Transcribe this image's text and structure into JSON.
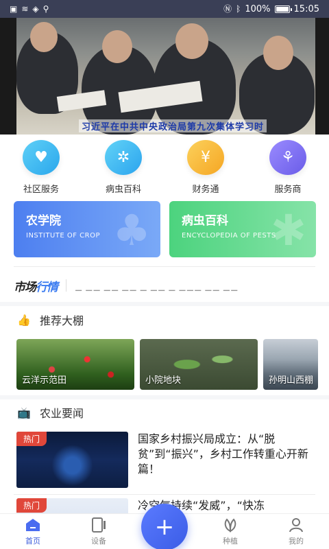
{
  "status_bar": {
    "battery": "100%",
    "time": "15:05",
    "battery_level": 1.0
  },
  "banner": {
    "caption": "习近平在中共中央政治局第九次集体学习时"
  },
  "services": [
    {
      "label": "社区服务",
      "icon": "community-heart-icon",
      "color": "#3bb8f0"
    },
    {
      "label": "病虫百科",
      "icon": "bug-icon",
      "color": "#3bbcf2"
    },
    {
      "label": "财务通",
      "icon": "piggy-bank-icon",
      "color": "#f7b733"
    },
    {
      "label": "服务商",
      "icon": "provider-icon",
      "color": "#7a6ff0"
    }
  ],
  "cards": [
    {
      "title": "农学院",
      "subtitle": "INSTITUTE OF CROP"
    },
    {
      "title": "病虫百科",
      "subtitle": "ENCYCLOPEDIA OF PESTS"
    }
  ],
  "market": {
    "logo_part1": "市场",
    "logo_part2": "行情"
  },
  "sections": {
    "greenhouses_title": "推荐大棚",
    "news_title": "农业要闻"
  },
  "greenhouses": [
    {
      "label": "云洋示范田"
    },
    {
      "label": "小院地块"
    },
    {
      "label": "孙明山西棚"
    }
  ],
  "news": [
    {
      "badge": "热门",
      "title": "国家乡村振兴局成立：从“脱贫”到“振兴”，乡村工作转重心开新篇！"
    },
    {
      "badge": "热门",
      "title": "冷空气持续“发威”，“快冻"
    }
  ],
  "bottom_nav": [
    {
      "label": "首页",
      "icon": "home-icon",
      "active": true
    },
    {
      "label": "设备",
      "icon": "device-icon",
      "active": false
    },
    {
      "label": "种植",
      "icon": "plant-icon",
      "active": false
    },
    {
      "label": "我的",
      "icon": "profile-icon",
      "active": false
    }
  ],
  "fab": {
    "icon": "plus-icon",
    "symbol": "+"
  }
}
